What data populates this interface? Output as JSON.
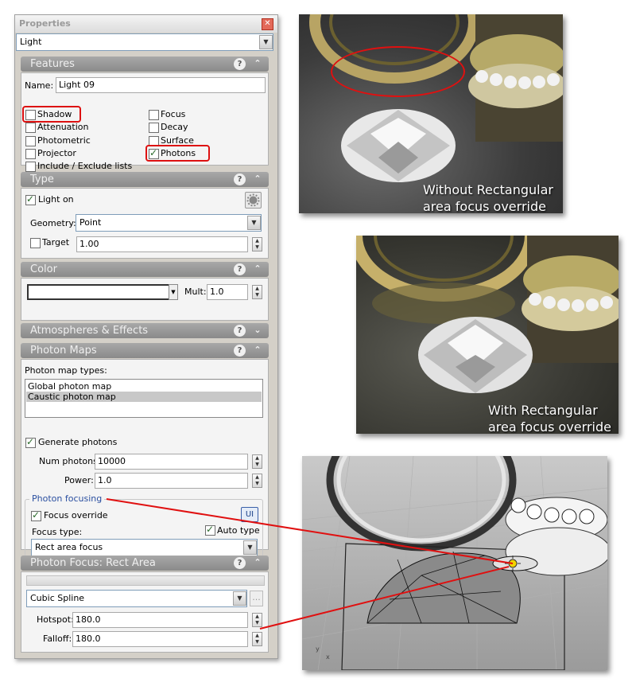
{
  "panel": {
    "title": "Properties",
    "object_type": "Light"
  },
  "features": {
    "header": "Features",
    "name_label": "Name:",
    "name_value": "Light 09",
    "options_left": [
      {
        "label": "Shadow",
        "checked": false,
        "highlighted": true
      },
      {
        "label": "Attenuation",
        "checked": false
      },
      {
        "label": "Photometric",
        "checked": false
      },
      {
        "label": "Projector",
        "checked": false
      },
      {
        "label": "Include / Exclude lists",
        "checked": false
      }
    ],
    "options_right": [
      {
        "label": "Focus",
        "checked": false
      },
      {
        "label": "Decay",
        "checked": false
      },
      {
        "label": "Surface",
        "checked": false
      },
      {
        "label": "Photons",
        "checked": true,
        "highlighted": true
      }
    ]
  },
  "type_section": {
    "header": "Type",
    "light_on_label": "Light on",
    "light_on_checked": true,
    "geometry_label": "Geometry:",
    "geometry_value": "Point",
    "target_label": "Target",
    "target_checked": false,
    "target_value": "1.00"
  },
  "color_section": {
    "header": "Color",
    "swatch_color": "#ffffff",
    "mult_label": "Mult:",
    "mult_value": "1.0"
  },
  "atmospheres": {
    "header": "Atmospheres & Effects"
  },
  "photon_maps": {
    "header": "Photon Maps",
    "types_label": "Photon map types:",
    "types": [
      {
        "label": "Global photon map",
        "selected": false
      },
      {
        "label": "Caustic photon map",
        "selected": true
      }
    ],
    "generate_label": "Generate photons",
    "generate_checked": true,
    "num_photons_label": "Num photons:",
    "num_photons_value": "10000",
    "power_label": "Power:",
    "power_value": "1.0",
    "focusing_group_label": "Photon focusing",
    "focus_override_label": "Focus override",
    "focus_override_checked": true,
    "ui_button_label": "UI",
    "auto_type_label": "Auto type",
    "auto_type_checked": true,
    "focus_type_label": "Focus type:",
    "focus_type_value": "Rect area focus"
  },
  "photon_focus": {
    "header": "Photon Focus: Rect Area",
    "curve_value": "Cubic Spline",
    "ellipsis_label": "...",
    "hotspot_label": "Hotspot:",
    "hotspot_value": "180.0",
    "falloff_label": "Falloff:",
    "falloff_value": "180.0"
  },
  "renders": {
    "without_caption_line1": "Without Rectangular",
    "without_caption_line2": "area focus override",
    "with_caption_line1": "With Rectangular",
    "with_caption_line2": "area focus override"
  },
  "icons": {
    "help": "?",
    "collapse": "⌃",
    "expand": "⌄",
    "close": "✕",
    "dropdown": "▼",
    "spin_up": "▲",
    "spin_down": "▼"
  },
  "viewport_axis": {
    "x": "x",
    "y": "y"
  },
  "colors": {
    "highlight_red": "#d11111",
    "gold": "#c8b070"
  }
}
